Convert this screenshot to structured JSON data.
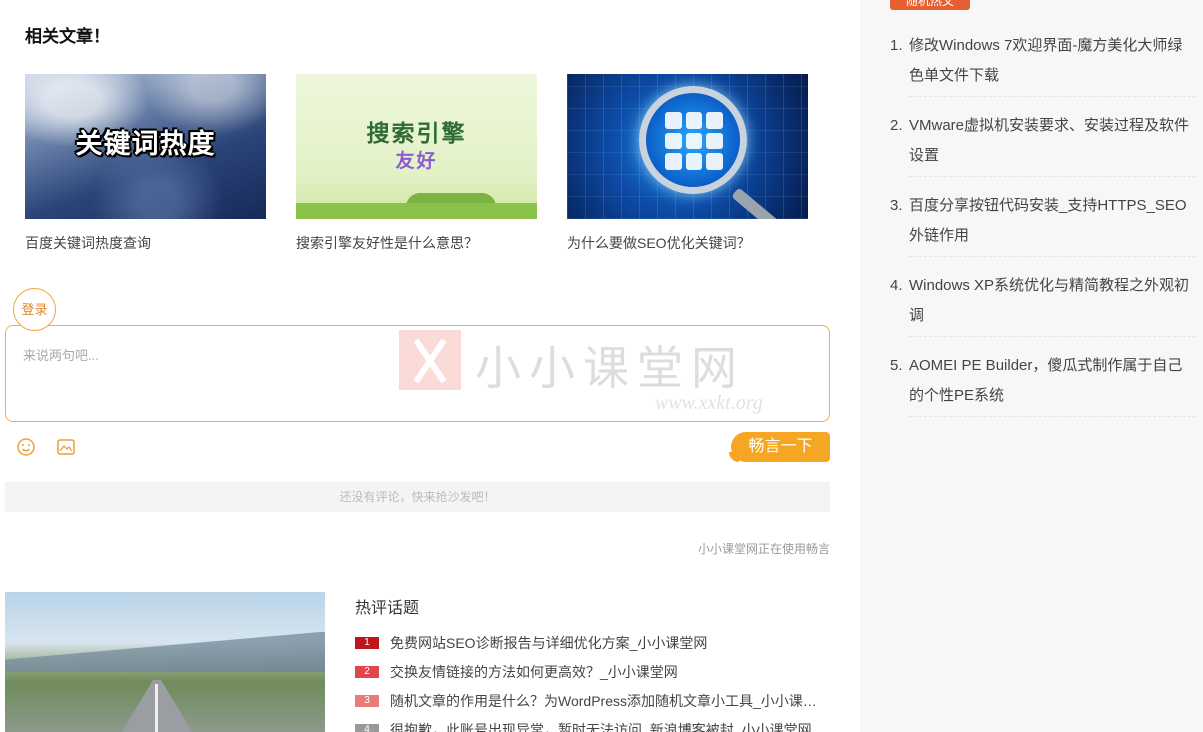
{
  "related": {
    "title": "相关文章！",
    "items": [
      {
        "caption": "百度关键词热度查询",
        "thumb_text": "关键词热度"
      },
      {
        "caption": "搜索引擎友好性是什么意思？",
        "thumb_text": "搜索引擎",
        "thumb_text2": "友好"
      },
      {
        "caption": "为什么要做SEO优化关键词？"
      }
    ]
  },
  "comment": {
    "login_label": "登录",
    "placeholder": "来说两句吧...",
    "submit_label": "畅言一下",
    "empty_text": "还没有评论，快来抢沙发吧！",
    "powered_by": "小小课堂网正在使用畅言",
    "watermark_name": "小小课堂网",
    "watermark_url": "www.xxkt.org"
  },
  "hot": {
    "title": "热评话题",
    "items": [
      {
        "rank": "1",
        "text": "免费网站SEO诊断报告与详细优化方案_小小课堂网",
        "color": "#c0151b"
      },
      {
        "rank": "2",
        "text": "交换友情链接的方法如何更高效？_小小课堂网",
        "color": "#e0474c"
      },
      {
        "rank": "3",
        "text": "随机文章的作用是什么？为WordPress添加随机文章小工具_小小课堂网",
        "color": "#ea7b7b"
      },
      {
        "rank": "4",
        "text": "很抱歉，此账号出现异常，暂时无法访问_新浪博客被封_小小课堂网",
        "color": "#999999"
      }
    ]
  },
  "sidebar": {
    "tag": "随机热文",
    "items": [
      {
        "num": "1.",
        "text": "修改Windows 7欢迎界面-魔方美化大师绿色单文件下载"
      },
      {
        "num": "2.",
        "text": "VMware虚拟机安装要求、安装过程及软件设置"
      },
      {
        "num": "3.",
        "text": "百度分享按钮代码安装_支持HTTPS_SEO外链作用"
      },
      {
        "num": "4.",
        "text": "Windows XP系统优化与精简教程之外观初调"
      },
      {
        "num": "5.",
        "text": "AOMEI PE Builder，傻瓜式制作属于自己的个性PE系统"
      }
    ]
  }
}
